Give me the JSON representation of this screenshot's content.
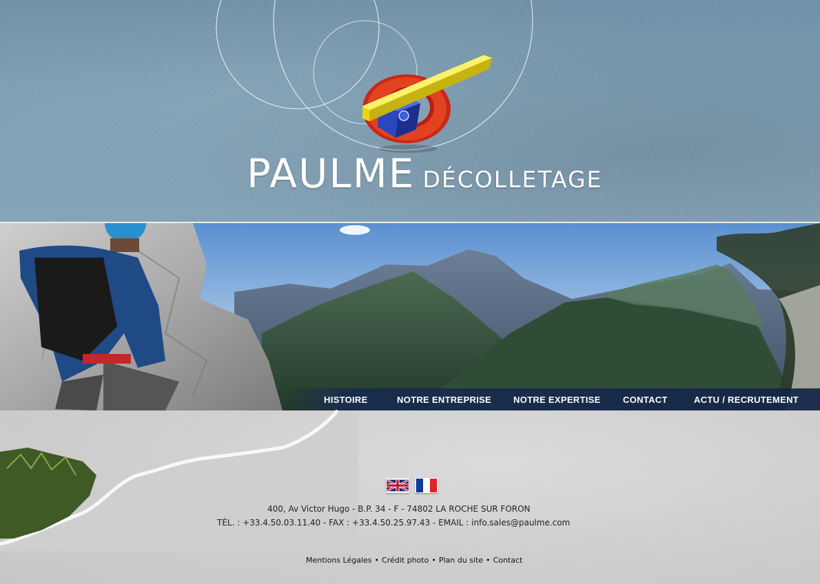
{
  "brand": {
    "name": "PAULME",
    "tagline": "DÉCOLLETAGE"
  },
  "nav": {
    "items": [
      {
        "label": "HISTOIRE"
      },
      {
        "label": "NOTRE ENTREPRISE"
      },
      {
        "label": "NOTRE EXPERTISE"
      },
      {
        "label": "CONTACT"
      },
      {
        "label": "ACTU / RECRUTEMENT"
      }
    ]
  },
  "languages": [
    {
      "code": "en",
      "icon": "uk-flag-icon"
    },
    {
      "code": "fr",
      "icon": "france-flag-icon"
    }
  ],
  "address": {
    "line1": "400, Av Victor Hugo - B.P. 34 - F - 74802 LA ROCHE SUR FORON",
    "line2": "TÉL. : +33.4.50.03.11.40  - FAX : +33.4.50.25.97.43 - EMAIL : info.sales@paulme.com"
  },
  "footer": {
    "links": [
      "Mentions Légales",
      "Crédit photo",
      "Plan du site",
      "Contact"
    ],
    "separator": "•"
  },
  "colors": {
    "header_blue": "#7d9db2",
    "nav_bar": "#162a52",
    "paper": "#cfcfcf",
    "logo_red": "#d8361e",
    "logo_blue": "#2e4fc7",
    "logo_yellow": "#f4e11a"
  }
}
